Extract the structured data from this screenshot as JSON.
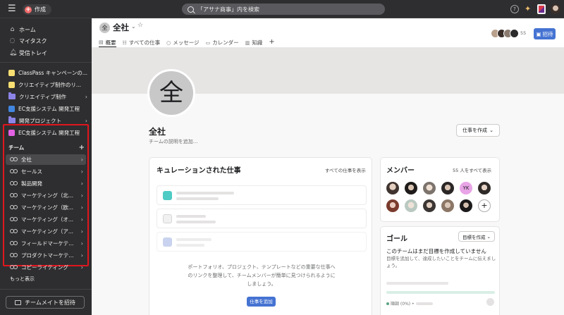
{
  "topbar": {
    "create_label": "作成",
    "search_placeholder": "「アサナ商事」内を検索",
    "help_label": "?"
  },
  "sidebar": {
    "nav": [
      {
        "label": "ホーム",
        "icon": "home-icon"
      },
      {
        "label": "マイタスク",
        "icon": "check-circle-icon"
      },
      {
        "label": "受信トレイ",
        "icon": "bell-icon"
      }
    ],
    "projects": [
      {
        "label": "ClassPass キャンペーンの...",
        "color": "#f8df72",
        "type": "project"
      },
      {
        "label": "クリエイティブ制作のリ...",
        "color": "#f8df72",
        "type": "project"
      },
      {
        "label": "クリエイティブ制作",
        "color": "#8d84e8",
        "type": "portfolio"
      },
      {
        "label": "EC支援システム 開発工程",
        "color": "#4186e0",
        "type": "project"
      },
      {
        "label": "開発プロジェクト",
        "color": "#8d84e8",
        "type": "portfolio"
      },
      {
        "label": "EC支援システム 開発工程",
        "color": "#e362e3",
        "type": "project"
      }
    ],
    "teams_header": "チーム",
    "teams": [
      {
        "label": "全社",
        "active": true
      },
      {
        "label": "セールス",
        "active": false
      },
      {
        "label": "製品開発",
        "active": false
      },
      {
        "label": "マーケティング（北...",
        "active": false
      },
      {
        "label": "マーケティング（欧...",
        "active": false
      },
      {
        "label": "マーケティング（オ...",
        "active": false
      },
      {
        "label": "マーケティング（ア...",
        "active": false
      },
      {
        "label": "フィールドマーケテ...",
        "active": false
      },
      {
        "label": "プロダクトマーケテ...",
        "active": false
      },
      {
        "label": "コピーライティング",
        "active": false
      }
    ],
    "show_more": "もっと表示",
    "invite_label": "チームメイトを招待"
  },
  "header": {
    "team_initial": "全",
    "team_name": "全社",
    "tabs": [
      {
        "label": "概要",
        "icon": "document-icon",
        "active": true
      },
      {
        "label": "すべての仕事",
        "icon": "list-icon",
        "active": false
      },
      {
        "label": "メッセージ",
        "icon": "chat-icon",
        "active": false
      },
      {
        "label": "カレンダー",
        "icon": "calendar-icon",
        "active": false
      },
      {
        "label": "知識",
        "icon": "book-icon",
        "active": false
      }
    ],
    "member_count": "55",
    "share_label": "招待"
  },
  "overview": {
    "avatar_char": "全",
    "title": "全社",
    "description_placeholder": "チームの説明を追加...",
    "create_work_label": "仕事を作成"
  },
  "curated": {
    "title": "キュレーションされた仕事",
    "view_all": "すべての仕事を表示",
    "description": "ポートフォリオ、プロジェクト、テンプレートなどの重要な仕事へのリンクを整理して、チームメンバーが簡単に見つけられるようにしましょう。",
    "add_button": "仕事を追加"
  },
  "members": {
    "title": "メンバー",
    "view_all": "55 人をすべて表示",
    "yk_initials": "YK"
  },
  "goals": {
    "title": "ゴール",
    "create_label": "目標を作成",
    "empty_title": "このチームはまだ目標を作成していません",
    "empty_desc": "目標を追加して、達成したいことをチームに伝えましょう。",
    "status_label": "順調 (0%) •"
  },
  "colors": {
    "accent": "#4573d2",
    "create_red": "#f06a6a",
    "highlight_red": "#e0161e",
    "sidebar_bg": "#2e2e30"
  }
}
